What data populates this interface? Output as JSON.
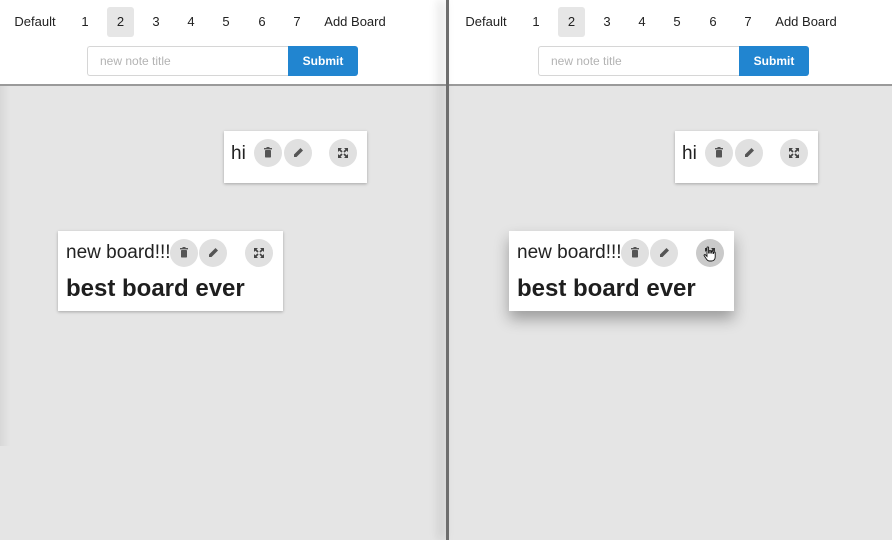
{
  "left": {
    "nav": {
      "items": [
        "Default",
        "1",
        "2",
        "3",
        "4",
        "5",
        "6",
        "7",
        "Add Board"
      ],
      "active": "2"
    },
    "form": {
      "placeholder": "new note title",
      "submit_label": "Submit"
    },
    "notes": [
      {
        "title": "hi",
        "body": ""
      },
      {
        "title": "new board!!!",
        "body": "best board ever"
      }
    ]
  },
  "right": {
    "nav": {
      "items": [
        "Default",
        "1",
        "2",
        "3",
        "4",
        "5",
        "6",
        "7",
        "Add Board"
      ],
      "active": "2"
    },
    "form": {
      "placeholder": "new note title",
      "submit_label": "Submit"
    },
    "notes": [
      {
        "title": "hi",
        "body": ""
      },
      {
        "title": "new board!!!",
        "body": "best board ever"
      }
    ]
  },
  "icons": [
    "trash-icon",
    "pencil-icon",
    "expand-icon",
    "hand-cursor-icon"
  ],
  "colors": {
    "accent": "#2185d0",
    "canvas": "#e5e5e5",
    "note": "#ffffff",
    "icon_button": "#e0e0e0"
  }
}
